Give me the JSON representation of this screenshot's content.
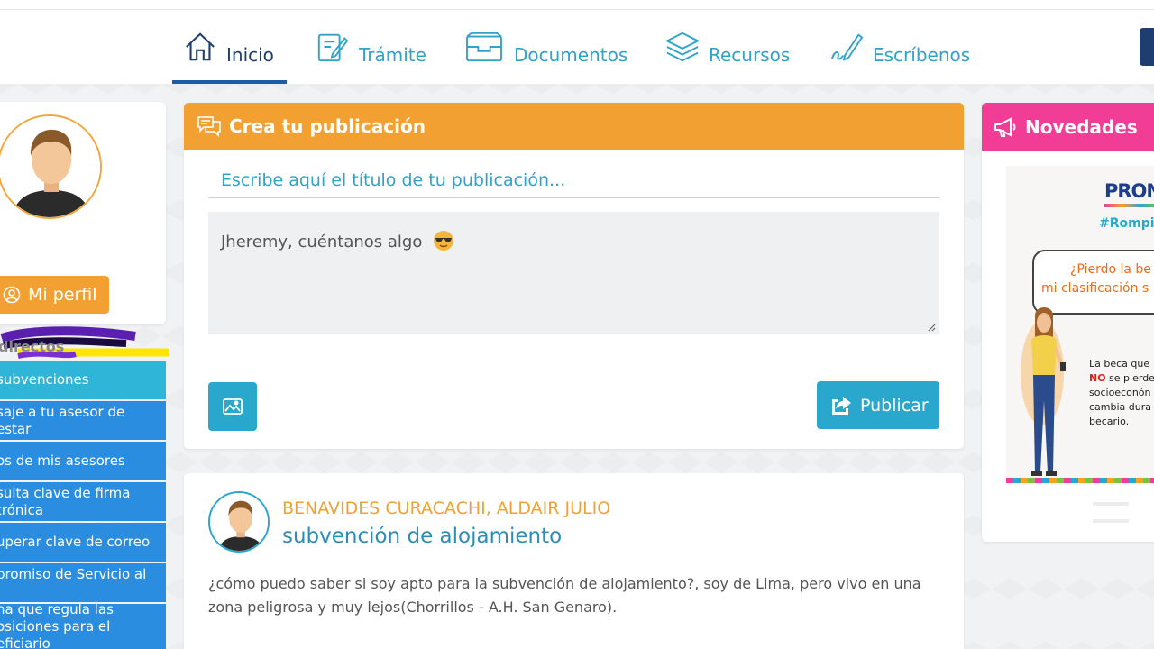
{
  "nav": {
    "items": [
      {
        "label": "Inicio",
        "icon": "home-icon",
        "active": true
      },
      {
        "label": "Trámite",
        "icon": "edit-document-icon",
        "active": false
      },
      {
        "label": "Documentos",
        "icon": "archive-box-icon",
        "active": false
      },
      {
        "label": "Recursos",
        "icon": "layers-icon",
        "active": false
      },
      {
        "label": "Escríbenos",
        "icon": "pencil-sign-icon",
        "active": false
      }
    ]
  },
  "profile": {
    "button_label": "Mi perfil"
  },
  "quick_links": {
    "title": "directos",
    "items": [
      "subvenciones",
      "saje a tu asesor de estar",
      "os de mis asesores",
      "sulta clave de firma trónica",
      "uperar clave de correo",
      "promiso de Servicio al",
      "na que regula las osiciones para el eficiario"
    ]
  },
  "create_post": {
    "header": "Crea tu publicación",
    "title_placeholder": "Escribe aquí el título de tu publicación...",
    "body_placeholder": "Jheremy, cuéntanos algo",
    "publish_label": "Publicar"
  },
  "post": {
    "author": "BENAVIDES CURACACHI, ALDAIR JULIO",
    "title": "subvención de alojamiento",
    "text": "¿cómo puedo saber si soy apto para la subvención de alojamiento?, soy de Lima, pero vivo en una zona peligrosa y muy lejos(Chorrillos - A.H. San Genaro)."
  },
  "news": {
    "header": "Novedades",
    "banner": {
      "brand": "PRON",
      "hashtag": "#Rompie",
      "question_line1": "¿Pierdo la be",
      "question_line2": "mi clasificación s",
      "text_line1": "La beca que",
      "text_line2_bold": "NO",
      "text_line2_rest": " se pierde",
      "text_line3": "socioeconón",
      "text_line4": "cambia dura",
      "text_line5": "becario."
    }
  },
  "colors": {
    "accent_orange": "#f3a032",
    "accent_cyan": "#2aa7cd",
    "accent_pink": "#f23d96",
    "link_blue": "#2a8de0",
    "nav_dark": "#1d3e6e"
  }
}
